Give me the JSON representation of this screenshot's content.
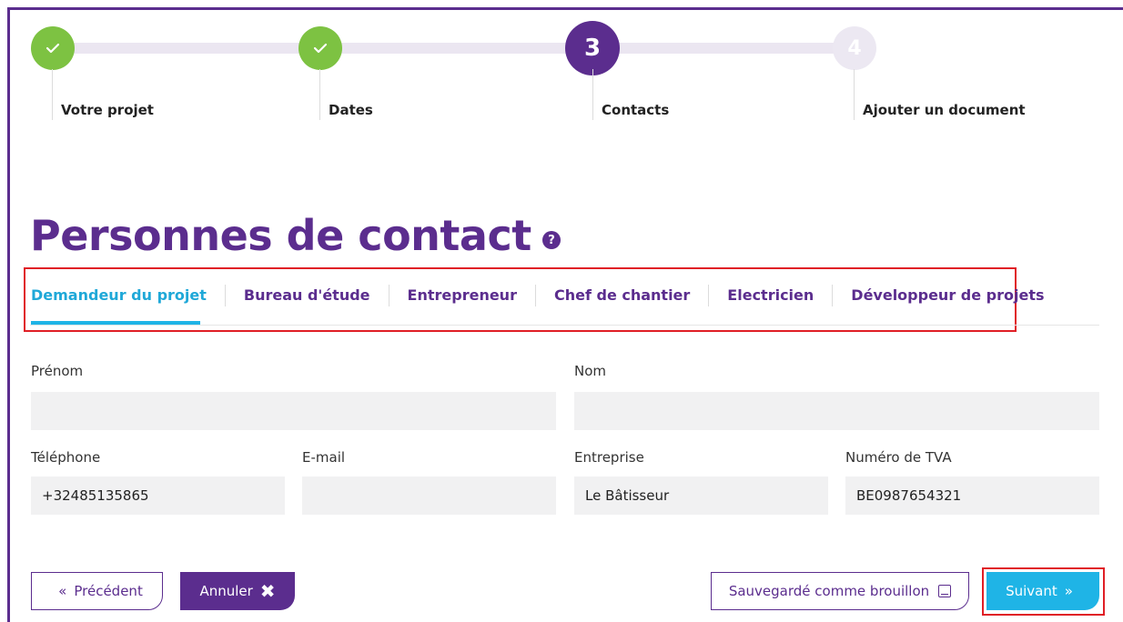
{
  "colors": {
    "brand_purple": "#5b2d8e",
    "accent_cyan": "#1fb4e6",
    "success_green": "#7dc242",
    "highlight_red": "#e01f26"
  },
  "stepper": {
    "steps": [
      {
        "label": "Votre projet",
        "state": "done",
        "marker": ""
      },
      {
        "label": "Dates",
        "state": "done",
        "marker": ""
      },
      {
        "label": "Contacts",
        "state": "active",
        "marker": "3"
      },
      {
        "label": "Ajouter un document",
        "state": "todo",
        "marker": "4"
      }
    ]
  },
  "page": {
    "title": "Personnes de contact",
    "help_icon": "?"
  },
  "tabs": [
    {
      "label": "Demandeur du projet",
      "active": true
    },
    {
      "label": "Bureau d'étude",
      "active": false
    },
    {
      "label": "Entrepreneur",
      "active": false
    },
    {
      "label": "Chef de chantier",
      "active": false
    },
    {
      "label": "Electricien",
      "active": false
    },
    {
      "label": "Développeur de projets",
      "active": false
    }
  ],
  "form": {
    "prenom": {
      "label": "Prénom",
      "value": ""
    },
    "nom": {
      "label": "Nom",
      "value": ""
    },
    "telephone": {
      "label": "Téléphone",
      "value": "+32485135865"
    },
    "email": {
      "label": "E-mail",
      "value": ""
    },
    "entreprise": {
      "label": "Entreprise",
      "value": "Le Bâtisseur"
    },
    "tva": {
      "label": "Numéro de TVA",
      "value": "BE0987654321"
    }
  },
  "buttons": {
    "prev": "Précédent",
    "prev_icon": "«",
    "cancel": "Annuler",
    "cancel_icon": "✖",
    "draft": "Sauvegardé comme brouillon",
    "next": "Suivant",
    "next_icon": "»"
  }
}
